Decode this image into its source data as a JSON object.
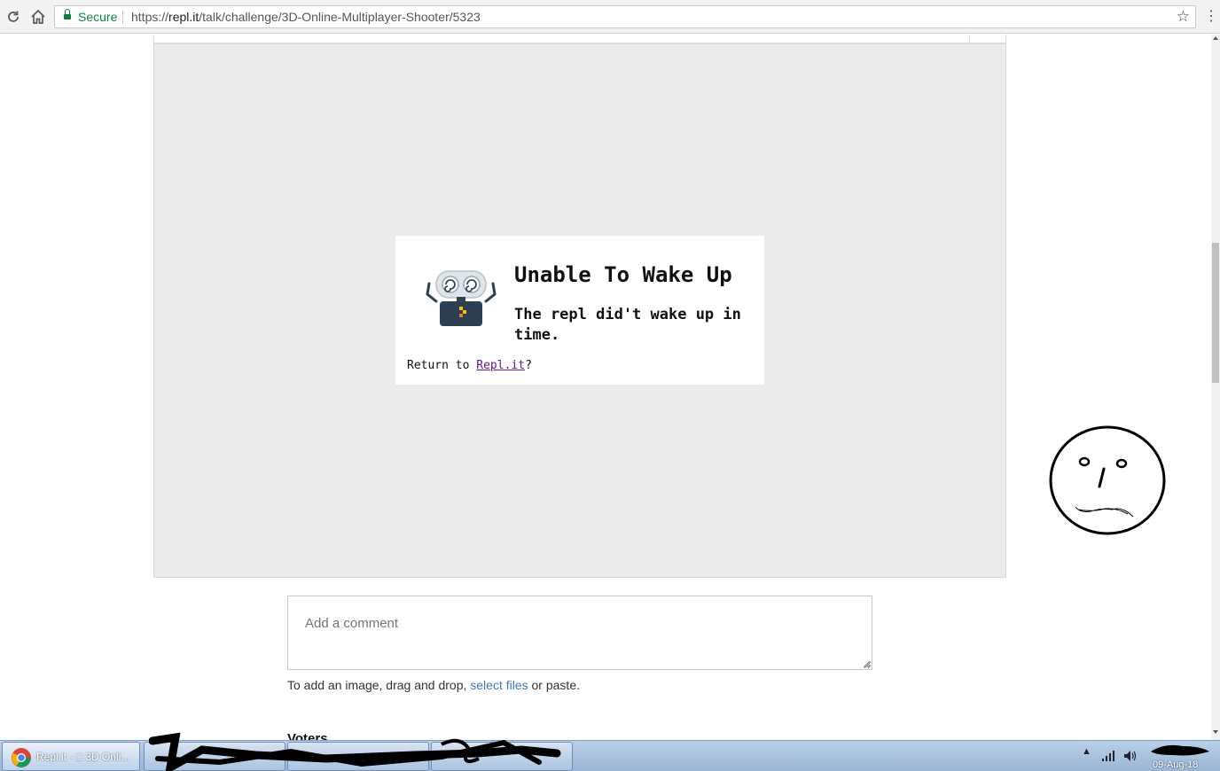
{
  "browser": {
    "secure_label": "Secure",
    "url_scheme": "https://",
    "url_host": "repl.it",
    "url_path": "/talk/challenge/3D-Online-Multiplayer-Shooter/5323",
    "icons": [
      "reload-icon",
      "home-icon",
      "lock-icon",
      "bookmark-star-icon",
      "menu-icon"
    ]
  },
  "embed": {
    "title": "Unable To Wake Up",
    "message": "The repl did't wake up in time.",
    "return_prefix": "Return to ",
    "return_link": "Repl.it",
    "return_suffix": "?",
    "link_color": "#551a8b"
  },
  "comment": {
    "placeholder": "Add a comment",
    "drop_hint_prefix": "To add an image, drag and drop, ",
    "drop_hint_link": "select files",
    "drop_hint_suffix": " or paste.",
    "link_color": "#3a7bbf"
  },
  "voters": {
    "heading": "Voters"
  },
  "taskbar": {
    "chrome_task_label": "Repl.it - □ 3D Onli...",
    "date": "09-Aug-18",
    "tray_icons": [
      "show-hidden-icons-icon",
      "network-icon",
      "volume-icon"
    ]
  }
}
